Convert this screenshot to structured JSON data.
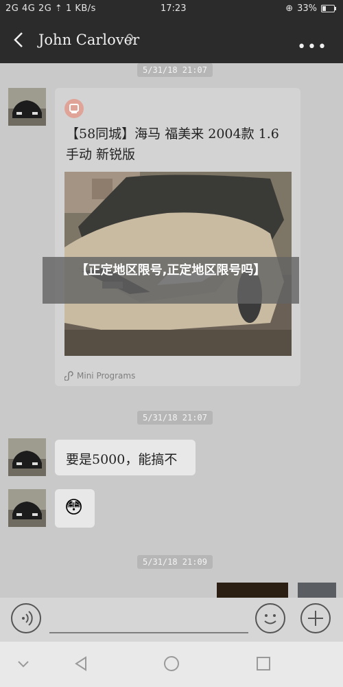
{
  "status": {
    "left": "2G  4G 2G  ⇡  1 KB/s",
    "time": "17:23",
    "battery": "33%",
    "battery_fraction": 0.33
  },
  "header": {
    "title": "John Carlover",
    "icons": [
      "back-arrow-icon",
      "ear-icon",
      "more-dots-icon"
    ]
  },
  "messages": {
    "timestamp1": "5/31/18 21:07",
    "card_title": "【58同城】海马 福美来 2004款 1.6 手动 新锐版",
    "card_footer": "Mini Programs",
    "timestamp2": "5/31/18 21:07",
    "text1": "要是5000，能搞不",
    "emoji": "😳",
    "timestamp3": "5/31/18 21:09"
  },
  "overlay": {
    "text": "【正定地区限号,正定地区限号吗】"
  },
  "input": {
    "icons": [
      "voice-icon",
      "emoji-icon",
      "plus-icon"
    ]
  },
  "nav": {
    "icons": [
      "collapse-icon",
      "back-triangle-icon",
      "home-circle-icon",
      "recents-square-icon"
    ]
  }
}
